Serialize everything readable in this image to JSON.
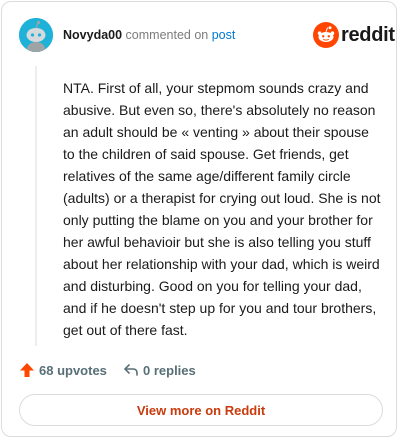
{
  "comment": {
    "username": "Novyda00",
    "action_text": "commented on",
    "post_link": "post",
    "body": "NTA. First of all, your stepmom sounds crazy and abusive. But even so, there's absolutely no reason an adult should be « venting » about their spouse to the children of said spouse. Get friends, get relatives of the same age/different family circle (adults) or a therapist for crying out loud. She is not only putting the blame on you and your brother for her awful behavioir but she is also telling you stuff about her relationship with your dad, which is weird and disturbing. Good on you for telling your dad, and if he doesn't step up for you and tour brothers, get out of there fast."
  },
  "brand": {
    "name": "reddit",
    "logo_icon": "reddit-snoo-icon",
    "accent": "#ff4500"
  },
  "actions": {
    "upvotes": "68 upvotes",
    "upvote_icon": "upvote-arrow-icon",
    "replies": "0 replies",
    "reply_icon": "reply-arrow-icon"
  },
  "footer": {
    "view_more": "View more on Reddit",
    "view_more_color": "#c93a0c"
  },
  "colors": {
    "avatar_bg": "#1eb2d8",
    "link": "#0079d3",
    "muted": "#7c7c7c"
  }
}
